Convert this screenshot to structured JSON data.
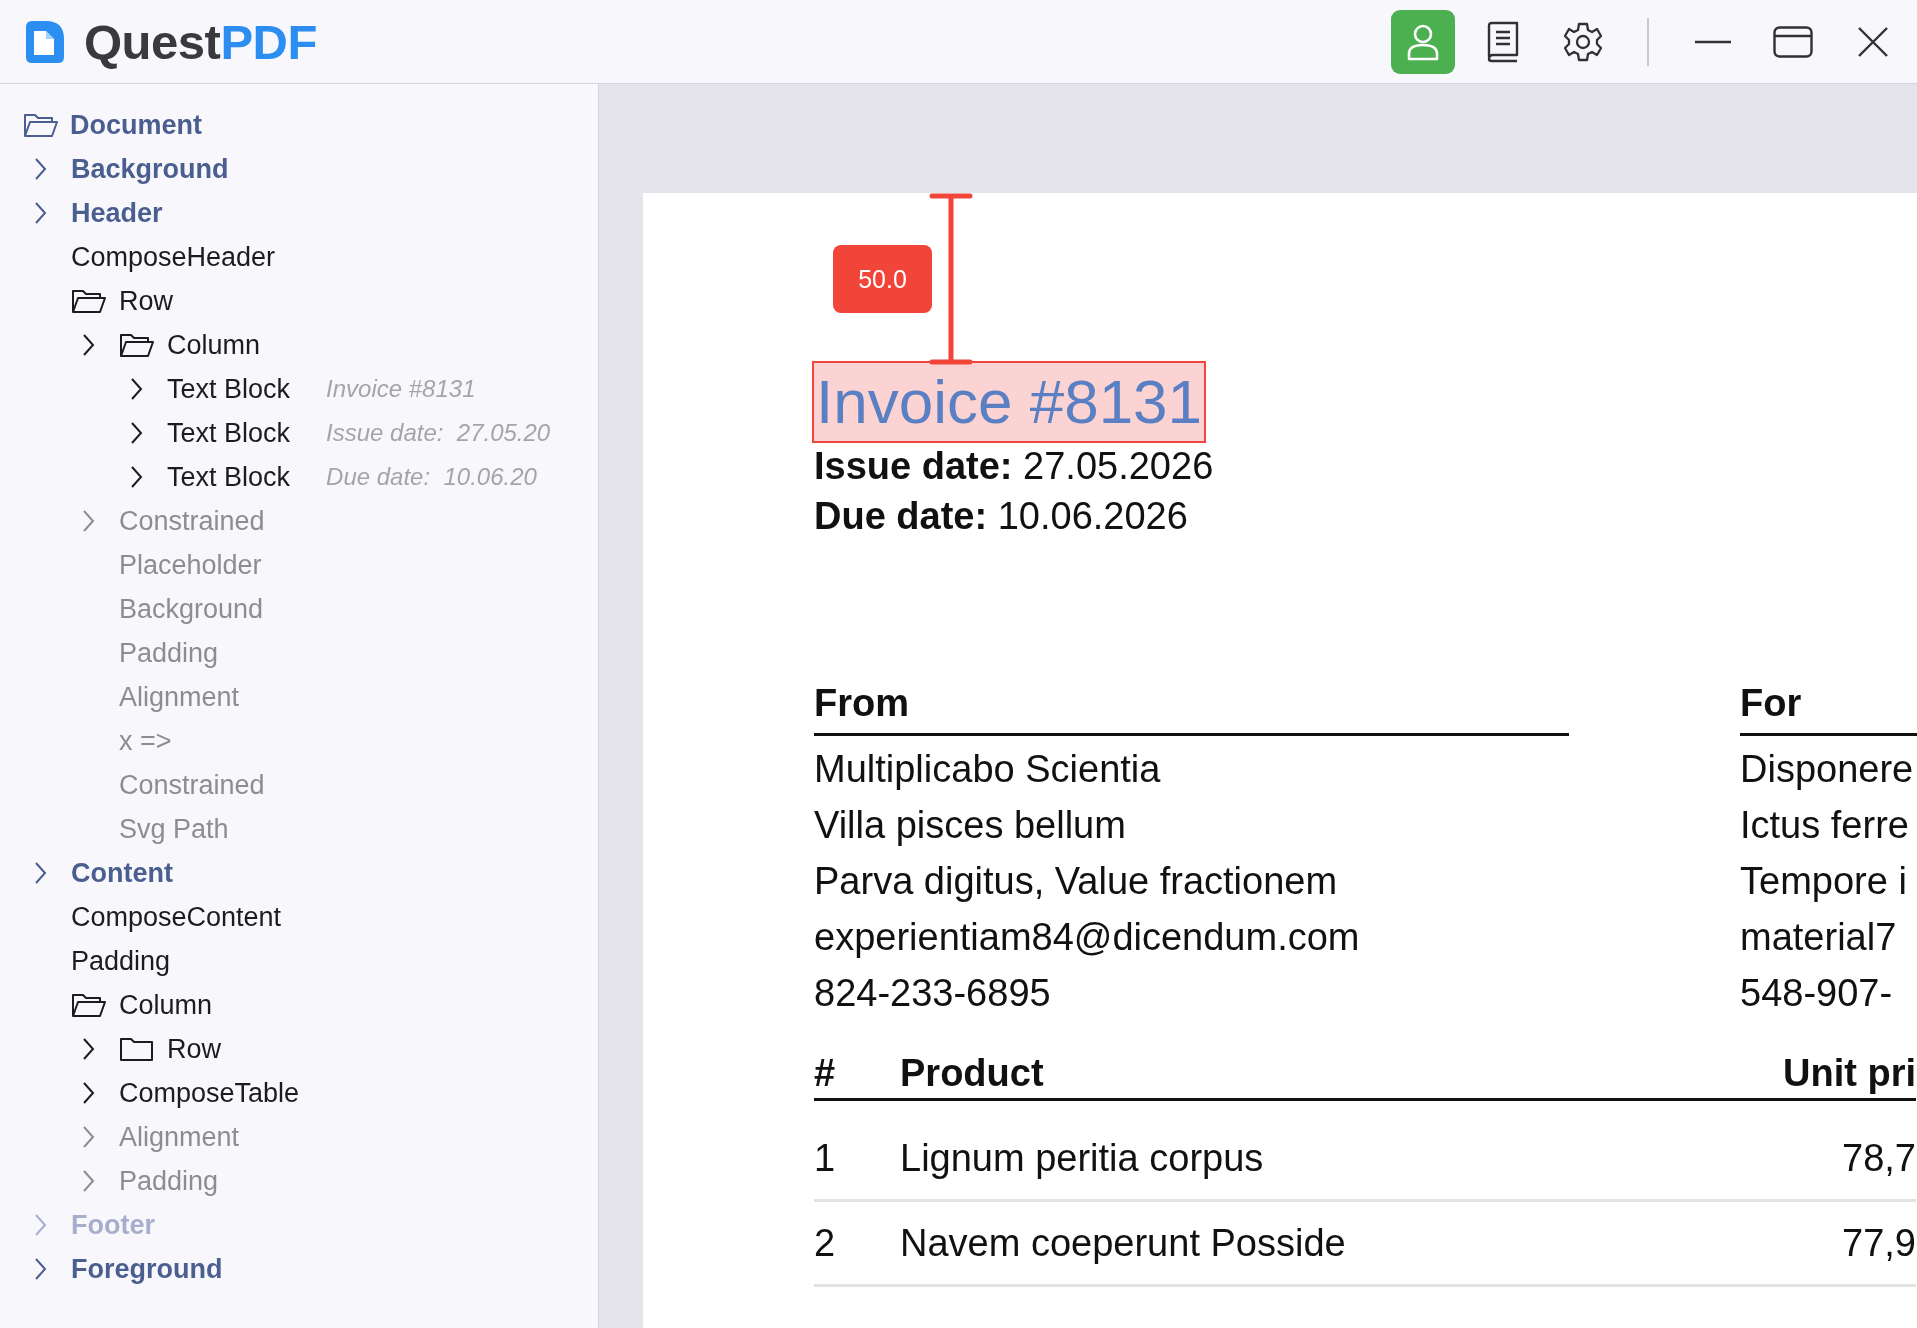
{
  "app": {
    "logo_primary": "Quest",
    "logo_secondary": "PDF"
  },
  "toolbar": [
    {
      "selected": true
    },
    {
      "selected": false
    },
    {
      "selected": false
    }
  ],
  "tree": [
    {
      "label": "Document",
      "kind": "root",
      "collapsible": false,
      "expanded": true,
      "disabled": false
    },
    {
      "label": "Background",
      "kind": "section",
      "collapsible": true,
      "disabled": false
    },
    {
      "label": "Header",
      "kind": "section",
      "collapsible": true,
      "disabled": false
    },
    {
      "label": "ComposeHeader",
      "kind": "node",
      "collapsible": false,
      "disabled": false
    },
    {
      "label": "Row",
      "kind": "container",
      "collapsible": false,
      "expanded": true,
      "disabled": false,
      "children": [
        {
          "label": "Column",
          "kind": "container",
          "collapsible": true,
          "expanded": true,
          "disabled": false,
          "children": [
            {
              "label": "Text Block",
              "kind": "node",
              "collapsible": true,
              "disabled": false,
              "preview": "Invoice #8131"
            },
            {
              "label": "Text Block",
              "kind": "node",
              "collapsible": true,
              "disabled": false,
              "preview": "Issue date:  27.05.20"
            },
            {
              "label": "Text Block",
              "kind": "node",
              "collapsible": true,
              "disabled": false,
              "preview": "Due date:  10.06.20"
            }
          ]
        },
        {
          "label": "Constrained",
          "kind": "node",
          "collapsible": true,
          "disabled": true
        },
        {
          "label": "Placeholder",
          "kind": "node",
          "collapsible": false,
          "disabled": true
        },
        {
          "label": "Background",
          "kind": "node",
          "collapsible": false,
          "disabled": true
        },
        {
          "label": "Padding",
          "kind": "node",
          "collapsible": false,
          "disabled": true
        },
        {
          "label": "Alignment",
          "kind": "node",
          "collapsible": false,
          "disabled": true
        },
        {
          "label": "x =>",
          "kind": "node",
          "collapsible": false,
          "disabled": true
        },
        {
          "label": "Constrained",
          "kind": "node",
          "collapsible": false,
          "disabled": true
        },
        {
          "label": "Svg Path",
          "kind": "node",
          "collapsible": false,
          "disabled": true
        }
      ]
    },
    {
      "label": "Content",
      "kind": "section",
      "collapsible": true,
      "disabled": false
    },
    {
      "label": "ComposeContent",
      "kind": "node",
      "collapsible": false,
      "disabled": false
    },
    {
      "label": "Padding",
      "kind": "node",
      "collapsible": false,
      "disabled": false
    },
    {
      "label": "Column",
      "kind": "container",
      "collapsible": false,
      "expanded": true,
      "disabled": false,
      "children": [
        {
          "label": "Row",
          "kind": "container",
          "collapsible": true,
          "expanded": false,
          "disabled": false
        },
        {
          "label": "ComposeTable",
          "kind": "node",
          "collapsible": true,
          "disabled": false
        },
        {
          "label": "Alignment",
          "kind": "node",
          "collapsible": true,
          "disabled": true
        },
        {
          "label": "Padding",
          "kind": "node",
          "collapsible": true,
          "disabled": true
        }
      ]
    },
    {
      "label": "Footer",
      "kind": "section",
      "collapsible": true,
      "disabled": true
    },
    {
      "label": "Foreground",
      "kind": "section",
      "collapsible": true,
      "disabled": false
    }
  ],
  "document": {
    "spacing_marker": "50.0",
    "title": "Invoice #8131",
    "title_highlighted": true,
    "meta": [
      "**Issue date:** 27.05.2026",
      "**Due date:** 10.06.2026"
    ],
    "parties": [
      {
        "heading": "From",
        "lines": [
          "Multiplicabo Scientia",
          "Villa pisces bellum",
          "Parva digitus, Value fractionem",
          "experientiam84@dicendum.com",
          "824-233-6895"
        ]
      },
      {
        "heading": "For",
        "lines": [
          "Disponere",
          "Ictus ferre",
          "Tempore i",
          "material7",
          "548-907-"
        ]
      }
    ],
    "table": {
      "columns": [
        "#",
        "Product",
        "Unit pri"
      ],
      "rows": [
        [
          "1",
          "Lignum peritia corpus",
          "78,7"
        ],
        [
          "2",
          "Navem coeperunt Posside",
          "77,9"
        ]
      ]
    }
  }
}
